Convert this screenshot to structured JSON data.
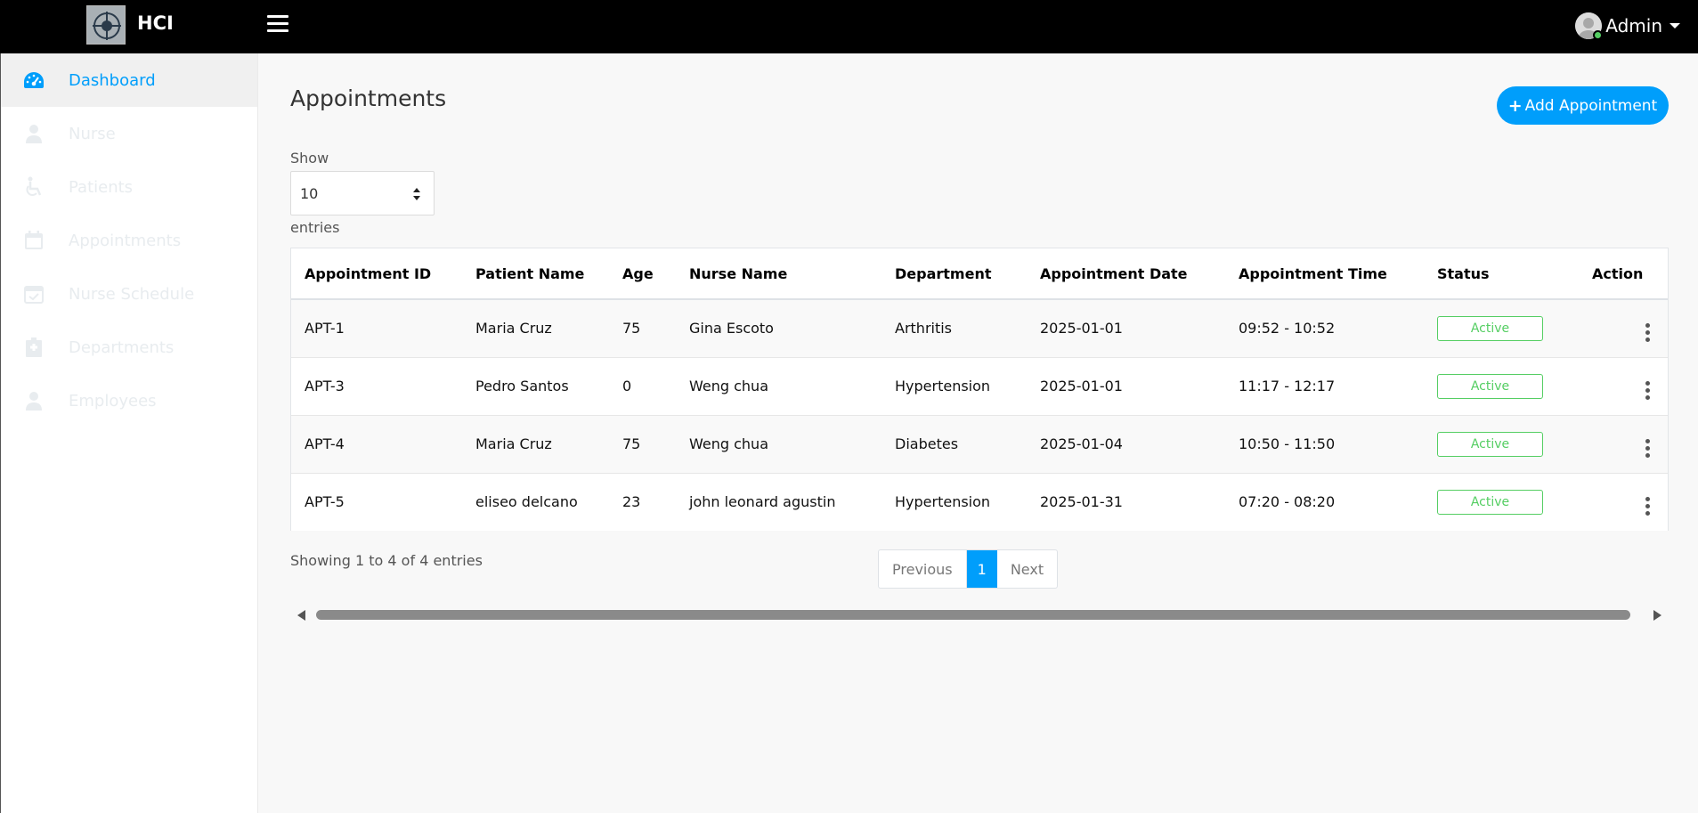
{
  "header": {
    "app_title": "HCI",
    "user_name": "Admin"
  },
  "sidebar": {
    "items": [
      {
        "label": "Dashboard",
        "icon": "dashboard-icon",
        "active": true
      },
      {
        "label": "Nurse",
        "icon": "user-nurse-icon"
      },
      {
        "label": "Patients",
        "icon": "wheelchair-icon"
      },
      {
        "label": "Appointments",
        "icon": "calendar-icon"
      },
      {
        "label": "Nurse Schedule",
        "icon": "calendar-check-icon"
      },
      {
        "label": "Departments",
        "icon": "hospital-icon"
      },
      {
        "label": "Employees",
        "icon": "user-icon"
      }
    ]
  },
  "page": {
    "title": "Appointments",
    "add_button_label": "Add Appointment",
    "show_label": "Show",
    "entries_value": "10",
    "entries_label": "entries",
    "showing_text": "Showing 1 to 4 of 4 entries"
  },
  "table": {
    "columns": [
      "Appointment ID",
      "Patient Name",
      "Age",
      "Nurse Name",
      "Department",
      "Appointment Date",
      "Appointment Time",
      "Status",
      "Action"
    ],
    "rows": [
      {
        "id": "APT-1",
        "patient": "Maria Cruz",
        "age": "75",
        "nurse": "Gina Escoto",
        "department": "Arthritis",
        "date": "2025-01-01",
        "time": "09:52 - 10:52",
        "status": "Active"
      },
      {
        "id": "APT-3",
        "patient": "Pedro Santos",
        "age": "0",
        "nurse": "Weng chua",
        "department": "Hypertension",
        "date": "2025-01-01",
        "time": "11:17 - 12:17",
        "status": "Active"
      },
      {
        "id": "APT-4",
        "patient": "Maria Cruz",
        "age": "75",
        "nurse": "Weng chua",
        "department": "Diabetes",
        "date": "2025-01-04",
        "time": "10:50 - 11:50",
        "status": "Active"
      },
      {
        "id": "APT-5",
        "patient": "eliseo delcano",
        "age": "23",
        "nurse": "john leonard agustin",
        "department": "Hypertension",
        "date": "2025-01-31",
        "time": "07:20 - 08:20",
        "status": "Active"
      }
    ]
  },
  "pagination": {
    "previous": "Previous",
    "current_page": "1",
    "next": "Next"
  },
  "colors": {
    "accent": "#009efb",
    "status_active": "#55ce63",
    "topbar": "#000000"
  }
}
